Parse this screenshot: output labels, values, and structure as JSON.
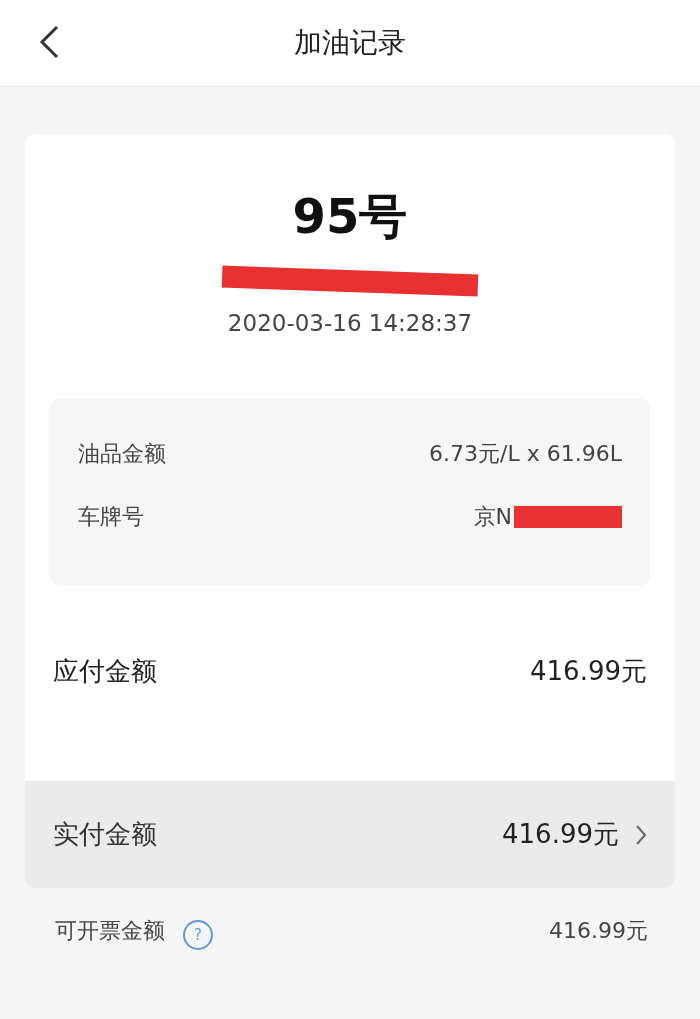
{
  "header": {
    "title": "加油记录"
  },
  "fuel_grade": "95号",
  "station": {
    "redacted": true
  },
  "time": "2020-03-16 14:28:37",
  "details": [
    {
      "label": "油品金额",
      "value": "6.73元/L x 61.96L",
      "redacted": false
    },
    {
      "label": "车牌号",
      "value": "京N",
      "redacted": true
    }
  ],
  "payable": {
    "label": "应付金额",
    "value": "416.99元"
  },
  "paid": {
    "label": "实付金额",
    "value": "416.99元"
  },
  "invoice": {
    "label": "可开票金额",
    "help": "?",
    "value": "416.99元"
  }
}
